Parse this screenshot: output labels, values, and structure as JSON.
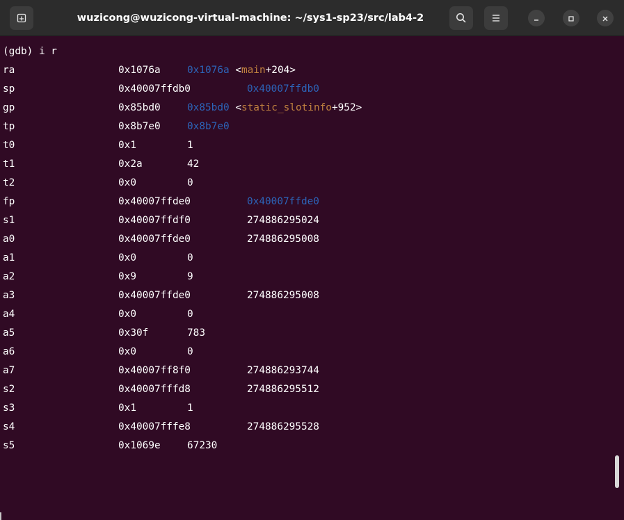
{
  "window": {
    "title": "wuzicong@wuzicong-virtual-machine: ~/sys1-sp23/src/lab4-2",
    "buttons": {
      "new_tab_icon": "new-tab-icon",
      "search_icon": "search-icon",
      "menu_icon": "hamburger-menu-icon",
      "minimize_icon": "minimize-icon",
      "maximize_icon": "maximize-icon",
      "close_icon": "close-icon"
    }
  },
  "colors": {
    "terminal_bg": "#300a24",
    "text": "#ffffff",
    "pointer": "#2c64b8",
    "symbol": "#c0813f"
  },
  "terminal": {
    "prompt": "(gdb) i r",
    "registers": [
      {
        "name": "ra",
        "hex": "0x1076a",
        "parts": [
          {
            "text": "0x1076a",
            "style": "ptr"
          },
          {
            "text": " <",
            "style": ""
          },
          {
            "text": "main",
            "style": "fn"
          },
          {
            "text": "+204>",
            "style": ""
          }
        ],
        "col": "short"
      },
      {
        "name": "sp",
        "hex": "0x40007ffdb0",
        "parts": [
          {
            "text": "0x40007ffdb0",
            "style": "ptr"
          }
        ],
        "col": "long"
      },
      {
        "name": "gp",
        "hex": "0x85bd0",
        "parts": [
          {
            "text": "0x85bd0",
            "style": "ptr"
          },
          {
            "text": " <",
            "style": ""
          },
          {
            "text": "static_slotinfo",
            "style": "fn"
          },
          {
            "text": "+952>",
            "style": ""
          }
        ],
        "col": "short"
      },
      {
        "name": "tp",
        "hex": "0x8b7e0",
        "parts": [
          {
            "text": "0x8b7e0",
            "style": "ptr"
          }
        ],
        "col": "short"
      },
      {
        "name": "t0",
        "hex": "0x1",
        "parts": [
          {
            "text": "1",
            "style": ""
          }
        ],
        "col": "short"
      },
      {
        "name": "t1",
        "hex": "0x2a",
        "parts": [
          {
            "text": "42",
            "style": ""
          }
        ],
        "col": "short"
      },
      {
        "name": "t2",
        "hex": "0x0",
        "parts": [
          {
            "text": "0",
            "style": ""
          }
        ],
        "col": "short"
      },
      {
        "name": "fp",
        "hex": "0x40007ffde0",
        "parts": [
          {
            "text": "0x40007ffde0",
            "style": "ptr"
          }
        ],
        "col": "long"
      },
      {
        "name": "s1",
        "hex": "0x40007ffdf0",
        "parts": [
          {
            "text": "274886295024",
            "style": ""
          }
        ],
        "col": "long"
      },
      {
        "name": "a0",
        "hex": "0x40007ffde0",
        "parts": [
          {
            "text": "274886295008",
            "style": ""
          }
        ],
        "col": "long"
      },
      {
        "name": "a1",
        "hex": "0x0",
        "parts": [
          {
            "text": "0",
            "style": ""
          }
        ],
        "col": "short"
      },
      {
        "name": "a2",
        "hex": "0x9",
        "parts": [
          {
            "text": "9",
            "style": ""
          }
        ],
        "col": "short"
      },
      {
        "name": "a3",
        "hex": "0x40007ffde0",
        "parts": [
          {
            "text": "274886295008",
            "style": ""
          }
        ],
        "col": "long"
      },
      {
        "name": "a4",
        "hex": "0x0",
        "parts": [
          {
            "text": "0",
            "style": ""
          }
        ],
        "col": "short"
      },
      {
        "name": "a5",
        "hex": "0x30f",
        "parts": [
          {
            "text": "783",
            "style": ""
          }
        ],
        "col": "short"
      },
      {
        "name": "a6",
        "hex": "0x0",
        "parts": [
          {
            "text": "0",
            "style": ""
          }
        ],
        "col": "short"
      },
      {
        "name": "a7",
        "hex": "0x40007ff8f0",
        "parts": [
          {
            "text": "274886293744",
            "style": ""
          }
        ],
        "col": "long"
      },
      {
        "name": "s2",
        "hex": "0x40007fffd8",
        "parts": [
          {
            "text": "274886295512",
            "style": ""
          }
        ],
        "col": "long"
      },
      {
        "name": "s3",
        "hex": "0x1",
        "parts": [
          {
            "text": "1",
            "style": ""
          }
        ],
        "col": "short"
      },
      {
        "name": "s4",
        "hex": "0x40007fffe8",
        "parts": [
          {
            "text": "274886295528",
            "style": ""
          }
        ],
        "col": "long"
      },
      {
        "name": "s5",
        "hex": "0x1069e",
        "parts": [
          {
            "text": "67230",
            "style": ""
          }
        ],
        "col": "short"
      }
    ]
  }
}
